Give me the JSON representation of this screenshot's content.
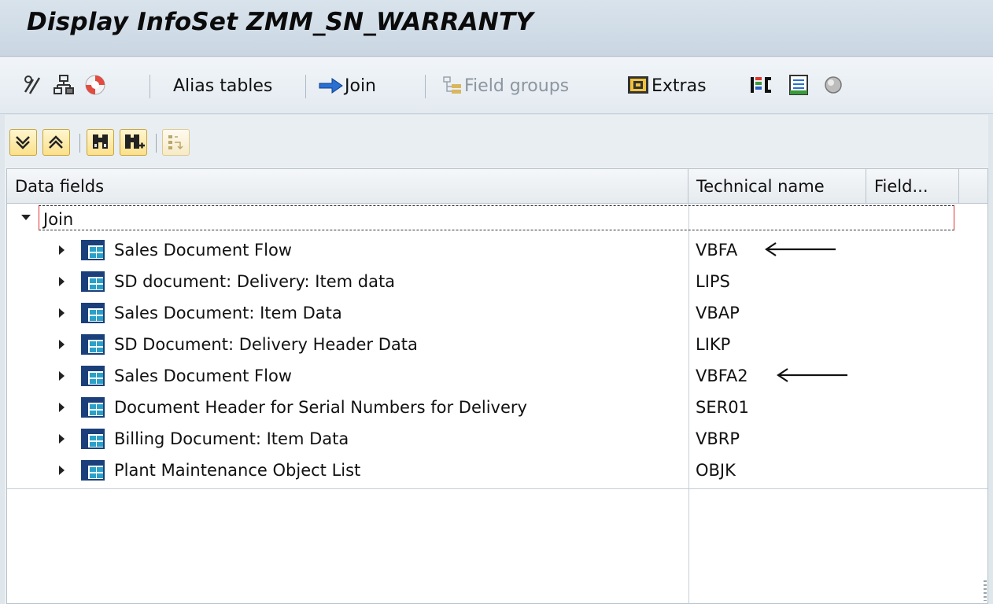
{
  "window": {
    "title": "Display InfoSet ZMM_SN_WARRANTY"
  },
  "toolbar": {
    "alias_tables": "Alias tables",
    "join": "Join",
    "field_groups": "Field groups",
    "extras": "Extras"
  },
  "grid": {
    "columns": [
      "Data fields",
      "Technical name",
      "Field..."
    ],
    "root": {
      "label": "Join"
    },
    "rows": [
      {
        "label": "Sales Document Flow",
        "tech": "VBFA",
        "annotated": true
      },
      {
        "label": "SD document: Delivery: Item data",
        "tech": "LIPS",
        "annotated": false
      },
      {
        "label": "Sales Document: Item Data",
        "tech": "VBAP",
        "annotated": false
      },
      {
        "label": "SD Document: Delivery Header Data",
        "tech": "LIKP",
        "annotated": false
      },
      {
        "label": "Sales Document Flow",
        "tech": "VBFA2",
        "annotated": true
      },
      {
        "label": "Document Header for Serial Numbers for Delivery",
        "tech": "SER01",
        "annotated": false
      },
      {
        "label": "Billing Document: Item Data",
        "tech": "VBRP",
        "annotated": false
      },
      {
        "label": "Plant Maintenance Object List",
        "tech": "OBJK",
        "annotated": false
      }
    ]
  },
  "icons": {
    "toolbar": [
      "edit-icon",
      "structure-icon",
      "lifebuoy-icon",
      "arrow-right-icon",
      "field-groups-icon",
      "extras-icon",
      "color-legend-icon",
      "list-icon",
      "status-light-icon"
    ],
    "subtoolbar": [
      "expand-all-icon",
      "collapse-all-icon",
      "find-icon",
      "find-next-icon",
      "sort-icon"
    ]
  },
  "colors": {
    "title_bg": "#d9e3ec",
    "button_yellow": "#fbe08a",
    "arrow_blue": "#2a6fd1"
  }
}
